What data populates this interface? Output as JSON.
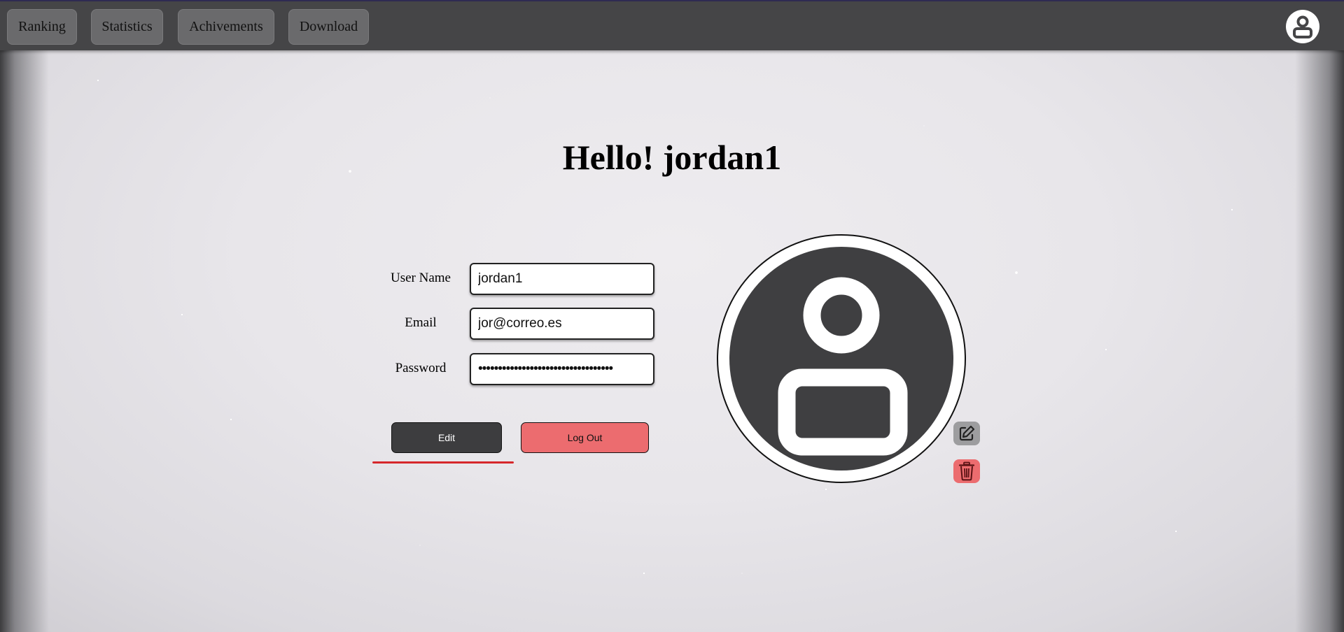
{
  "nav": {
    "items": [
      {
        "label": "Ranking"
      },
      {
        "label": "Statistics"
      },
      {
        "label": "Achivements"
      },
      {
        "label": "Download"
      }
    ],
    "profile_icon": "user-icon"
  },
  "greeting": "Hello! jordan1",
  "form": {
    "username": {
      "label": "User Name",
      "value": "jordan1"
    },
    "email": {
      "label": "Email",
      "value": "jor@correo.es"
    },
    "password": {
      "label": "Password",
      "value": "••••••••••••••••••••••••••••••••••"
    }
  },
  "actions": {
    "edit_label": "Edit",
    "logout_label": "Log Out"
  },
  "avatar": {
    "icon": "user-avatar-icon",
    "edit_icon": "pencil-square-icon",
    "delete_icon": "trash-icon"
  },
  "colors": {
    "topbar": "#454547",
    "edit_button": "#3d3d3f",
    "logout_button": "#ec6c6f",
    "accent_red": "#d6272b"
  }
}
